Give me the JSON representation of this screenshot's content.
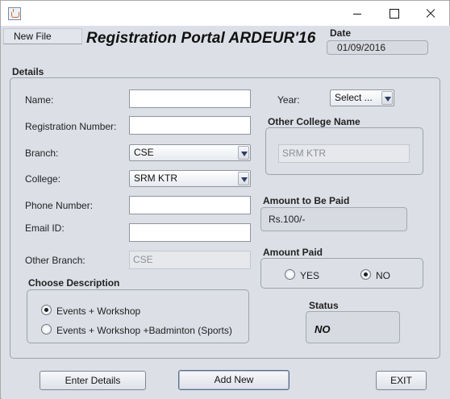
{
  "window": {
    "controls": {
      "minimize": "minimize",
      "maximize": "maximize",
      "close": "close"
    }
  },
  "menu": {
    "new_file": "New File"
  },
  "app_title": "Registration Portal ARDEUR'16",
  "date": {
    "label": "Date",
    "value": "01/09/2016"
  },
  "details": {
    "label": "Details",
    "name_label": "Name:",
    "regno_label": "Registration Number:",
    "branch_label": "Branch:",
    "branch_value": "CSE",
    "college_label": "College:",
    "college_value": "SRM KTR",
    "phone_label": "Phone Number:",
    "email_label": "Email ID:",
    "other_branch_label": "Other Branch:",
    "other_branch_value": "CSE",
    "year_label": "Year:",
    "year_value": "Select ...",
    "other_college_label": "Other College Name",
    "other_college_value": "SRM KTR",
    "amount_due_label": "Amount to Be Paid",
    "amount_due_value": "Rs.100/-",
    "amount_paid_label": "Amount Paid",
    "amount_paid_yes": "YES",
    "amount_paid_no": "NO",
    "choose_label": "Choose Description",
    "option_1": "Events + Workshop",
    "option_2": "Events + Workshop +Badminton (Sports)",
    "status_label": "Status",
    "status_value": "NO"
  },
  "buttons": {
    "enter": "Enter Details",
    "add": "Add New",
    "exit": "EXIT"
  }
}
